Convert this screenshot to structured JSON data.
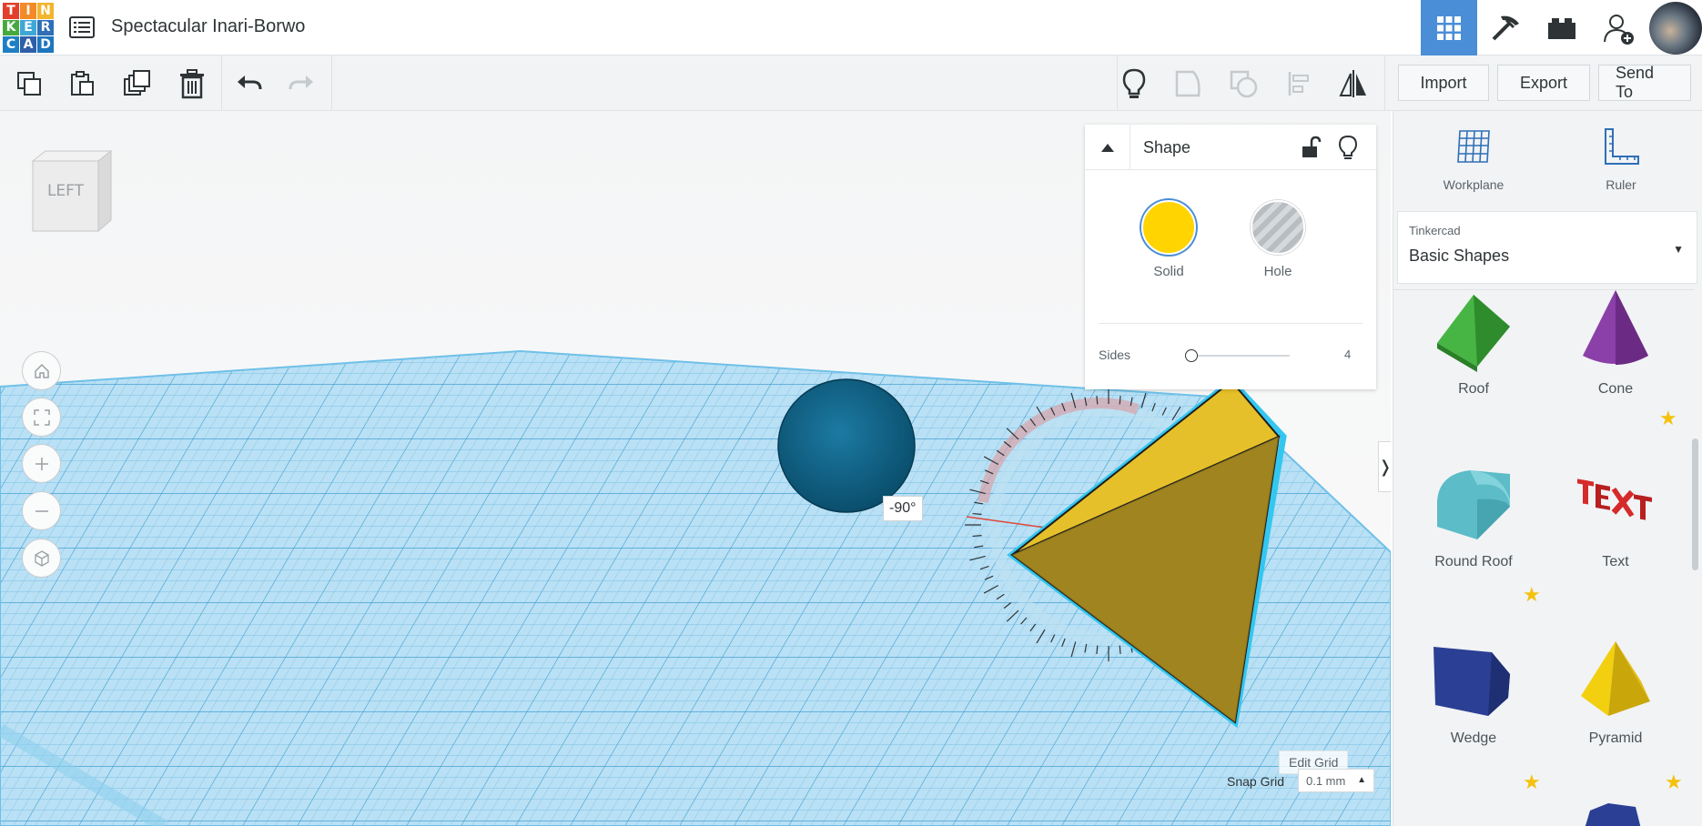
{
  "app": {
    "logo_letters": [
      "T",
      "I",
      "N",
      "K",
      "E",
      "R",
      "C",
      "A",
      "D"
    ],
    "logo_colors": [
      "#e2402c",
      "#f38a28",
      "#f1b52e",
      "#46a940",
      "#3fa7d6",
      "#2f6fb7",
      "#1e7fc5",
      "#2e5fa8",
      "#1d76bd"
    ],
    "design_title": "Spectacular Inari-Borwo"
  },
  "header_buttons": {
    "grid_view": "grid-view-icon",
    "build_view": "pickaxe-icon",
    "bricks_view": "bricks-icon",
    "add_user": "add-user-icon"
  },
  "toolbar": {
    "import_label": "Import",
    "export_label": "Export",
    "send_to_label": "Send To"
  },
  "viewcube": {
    "face_label": "LEFT"
  },
  "inspector": {
    "title": "Shape",
    "solid_label": "Solid",
    "hole_label": "Hole",
    "sides_label": "Sides",
    "sides_value": "4",
    "solid_color": "#ffd400"
  },
  "scene": {
    "rotation_angle": "-90°",
    "edit_grid_label": "Edit Grid",
    "snap_grid_label": "Snap Grid",
    "snap_grid_value": "0.1 mm"
  },
  "right_panel": {
    "workplane_label": "Workplane",
    "ruler_label": "Ruler",
    "library_source": "Tinkercad",
    "library_name": "Basic Shapes",
    "shapes": [
      {
        "name": "Roof",
        "color": "#3ea53a"
      },
      {
        "name": "Cone",
        "color": "#8b3fa8"
      },
      {
        "name": "Round Roof",
        "color": "#5cbcc8"
      },
      {
        "name": "Text",
        "color": "#d62a2a"
      },
      {
        "name": "Wedge",
        "color": "#2b3f94"
      },
      {
        "name": "Pyramid",
        "color": "#f2cf0f"
      }
    ]
  }
}
